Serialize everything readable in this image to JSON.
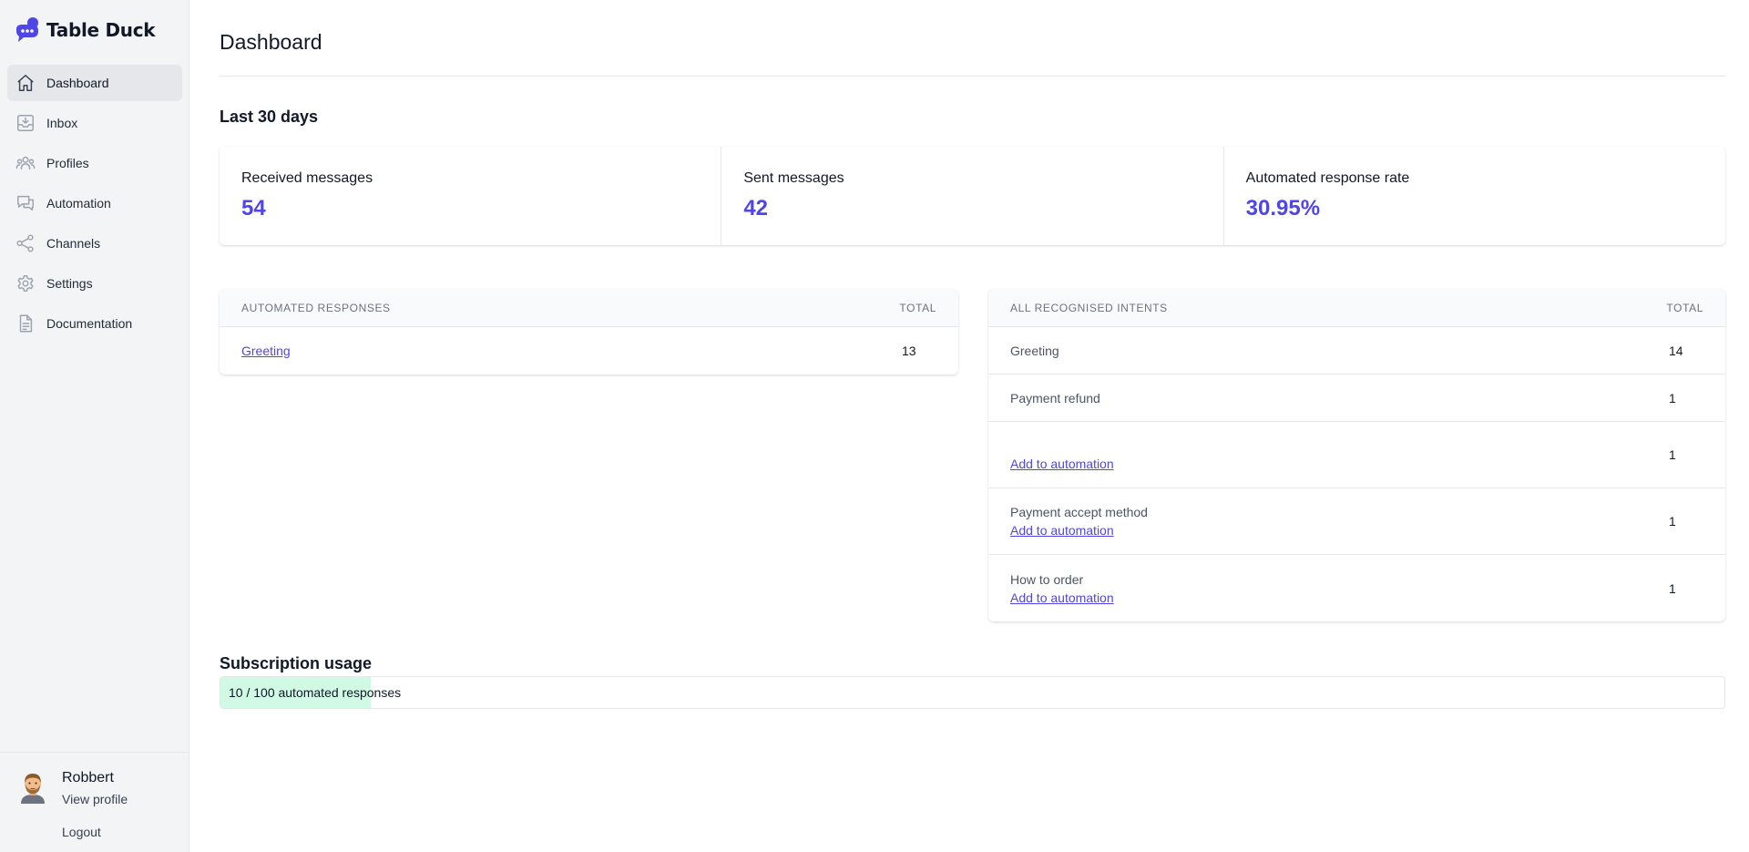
{
  "app": {
    "name": "Table Duck",
    "accent": "#4f46e5"
  },
  "sidebar": {
    "items": [
      {
        "label": "Dashboard",
        "icon": "home-icon",
        "active": true
      },
      {
        "label": "Inbox",
        "icon": "inbox-icon"
      },
      {
        "label": "Profiles",
        "icon": "users-icon"
      },
      {
        "label": "Automation",
        "icon": "chat-icon"
      },
      {
        "label": "Channels",
        "icon": "share-icon"
      },
      {
        "label": "Settings",
        "icon": "gear-icon"
      },
      {
        "label": "Documentation",
        "icon": "document-icon"
      }
    ],
    "user": {
      "name": "Robbert",
      "view_profile": "View profile",
      "logout": "Logout"
    }
  },
  "header": {
    "title": "Dashboard"
  },
  "period": {
    "title": "Last 30 days"
  },
  "stats": [
    {
      "label": "Received messages",
      "value": "54"
    },
    {
      "label": "Sent messages",
      "value": "42"
    },
    {
      "label": "Automated response rate",
      "value": "30.95%"
    }
  ],
  "automated_responses": {
    "headers": {
      "name": "Automated responses",
      "total": "Total"
    },
    "rows": [
      {
        "name": "Greeting",
        "total": "13"
      }
    ]
  },
  "intents": {
    "headers": {
      "name": "All recognised intents",
      "total": "Total"
    },
    "rows": [
      {
        "name": "Greeting",
        "link": "",
        "total": "14"
      },
      {
        "name": "Payment refund",
        "link": "",
        "total": "1"
      },
      {
        "name": "",
        "link": "Add to automation",
        "total": "1"
      },
      {
        "name": "Payment accept method",
        "link": "Add to automation",
        "total": "1"
      },
      {
        "name": "How to order",
        "link": "Add to automation",
        "total": "1"
      }
    ]
  },
  "subscription": {
    "title": "Subscription usage",
    "label": "10 / 100 automated responses",
    "used": 10,
    "limit": 100
  }
}
